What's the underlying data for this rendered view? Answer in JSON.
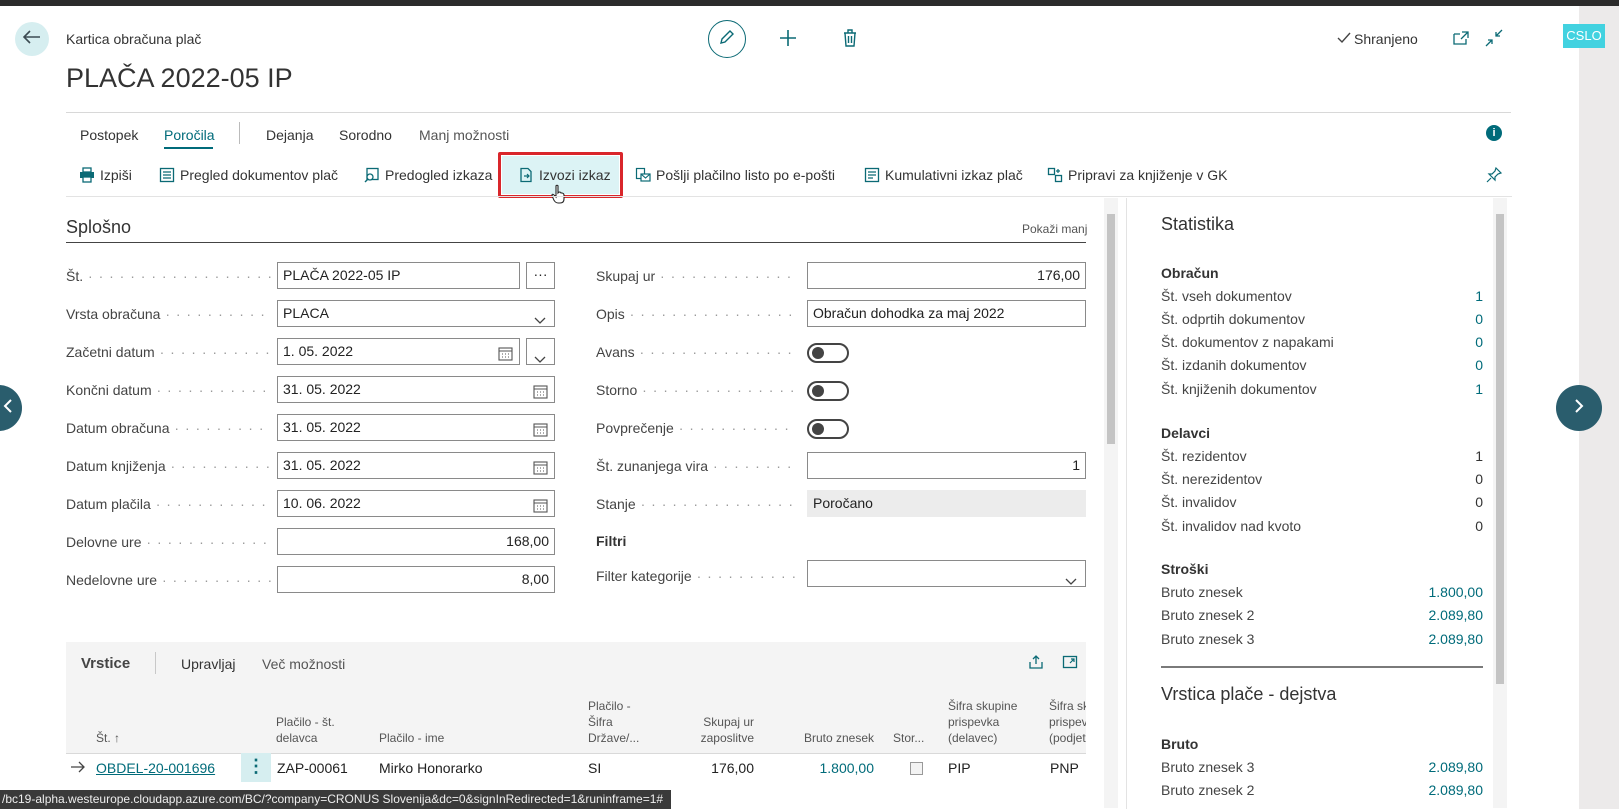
{
  "window": {
    "cslo": "CSLO"
  },
  "header": {
    "breadcrumb": "Kartica obračuna plač",
    "title": "PLAČA 2022-05 IP",
    "saved": "Shranjeno"
  },
  "tabs": [
    "Postopek",
    "Poročila",
    "Dejanja",
    "Sorodno",
    "Manj možnosti"
  ],
  "actions": [
    "Izpiši",
    "Pregled dokumentov plač",
    "Predogled izkaza",
    "Izvozi izkaz",
    "Pošlji plačilno listo po e-pošti",
    "Kumulativni izkaz plač",
    "Pripravi za knjiženje v GK"
  ],
  "general": {
    "title": "Splošno",
    "show_less": "Pokaži manj",
    "left": [
      {
        "label": "Št.",
        "value": "PLAČA 2022-05 IP"
      },
      {
        "label": "Vrsta obračuna",
        "value": "PLACA"
      },
      {
        "label": "Začetni datum",
        "value": "1. 05. 2022"
      },
      {
        "label": "Končni datum",
        "value": "31. 05. 2022"
      },
      {
        "label": "Datum obračuna",
        "value": "31. 05. 2022"
      },
      {
        "label": "Datum knjiženja",
        "value": "31. 05. 2022"
      },
      {
        "label": "Datum plačila",
        "value": "10. 06. 2022"
      },
      {
        "label": "Delovne ure",
        "value": "168,00"
      },
      {
        "label": "Nedelovne ure",
        "value": "8,00"
      }
    ],
    "right": [
      {
        "label": "Skupaj ur",
        "value": "176,00"
      },
      {
        "label": "Opis",
        "value": "Obračun dohodka za maj 2022"
      },
      {
        "label": "Avans"
      },
      {
        "label": "Storno"
      },
      {
        "label": "Povprečenje"
      },
      {
        "label": "Št. zunanjega vira",
        "value": "1"
      },
      {
        "label": "Stanje",
        "value": "Poročano"
      }
    ],
    "filters_head": "Filtri",
    "filter_label": "Filter kategorije"
  },
  "lines": {
    "title": "Vrstice",
    "manage": "Upravljaj",
    "more": "Več možnosti",
    "columns": [
      "Št. ↑",
      "Plačilo - št. delavca",
      "Plačilo - ime",
      "Plačilo - Šifra Države/...",
      "Skupaj ur zaposlitve",
      "Bruto znesek",
      "Stor...",
      "Šifra skupine prispevka (delavec)",
      "Šifra sk... prispev... (podjet..."
    ],
    "row": {
      "no": "OBDEL-20-001696",
      "emp": "ZAP-00061",
      "name": "Mirko  Honorarko",
      "country": "SI",
      "hours": "176,00",
      "gross": "1.800,00",
      "grp1": "PIP",
      "grp2": "PNP"
    }
  },
  "stats": {
    "title": "Statistika",
    "obracun_head": "Obračun",
    "obracun": [
      {
        "label": "Št. vseh dokumentov",
        "value": "1"
      },
      {
        "label": "Št. odprtih dokumentov",
        "value": "0"
      },
      {
        "label": "Št. dokumentov z napakami",
        "value": "0"
      },
      {
        "label": "Št. izdanih dokumentov",
        "value": "0"
      },
      {
        "label": "Št. knjiženih dokumentov",
        "value": "1"
      }
    ],
    "delavci_head": "Delavci",
    "delavci": [
      {
        "label": "Št. rezidentov",
        "value": "1"
      },
      {
        "label": "Št. nerezidentov",
        "value": "0"
      },
      {
        "label": "Št. invalidov",
        "value": "0"
      },
      {
        "label": "Št. invalidov nad kvoto",
        "value": "0"
      }
    ],
    "stroski_head": "Stroški",
    "stroski": [
      {
        "label": "Bruto znesek",
        "value": "1.800,00"
      },
      {
        "label": "Bruto znesek 2",
        "value": "2.089,80"
      },
      {
        "label": "Bruto znesek 3",
        "value": "2.089,80"
      }
    ],
    "facts_title": "Vrstica plače - dejstva",
    "bruto_head": "Bruto",
    "bruto": [
      {
        "label": "Bruto znesek 3",
        "value": "2.089,80"
      },
      {
        "label": "Bruto znesek 2",
        "value": "2.089,80"
      }
    ]
  },
  "status_url": "/bc19-alpha.westeurope.cloudapp.azure.com/BC/?company=CRONUS Slovenija&dc=0&signInRedirected=1&runinframe=1#",
  "colors": {
    "accent": "#006b7a",
    "highlight": "#d9262b"
  }
}
